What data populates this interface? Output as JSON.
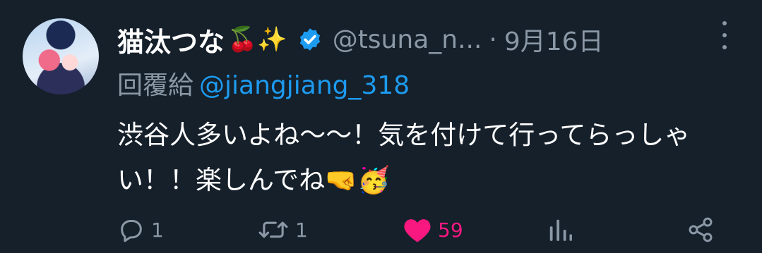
{
  "tweet": {
    "display_name": "猫汰つな",
    "name_emojis": "🍒✨",
    "handle": "@tsuna_n...",
    "separator": "·",
    "date": "9月16日",
    "reply_prefix": "回覆給",
    "reply_to": "@jiangjiang_318",
    "text": "渋谷人多いよね〜〜！気を付けて行ってらっしゃい！！楽しんでね🤜🥳"
  },
  "actions": {
    "reply_count": "1",
    "retweet_count": "1",
    "like_count": "59"
  },
  "colors": {
    "background": "#15202b",
    "secondary_text": "#8b98a5",
    "link": "#1d9bf0",
    "like": "#f91880"
  }
}
